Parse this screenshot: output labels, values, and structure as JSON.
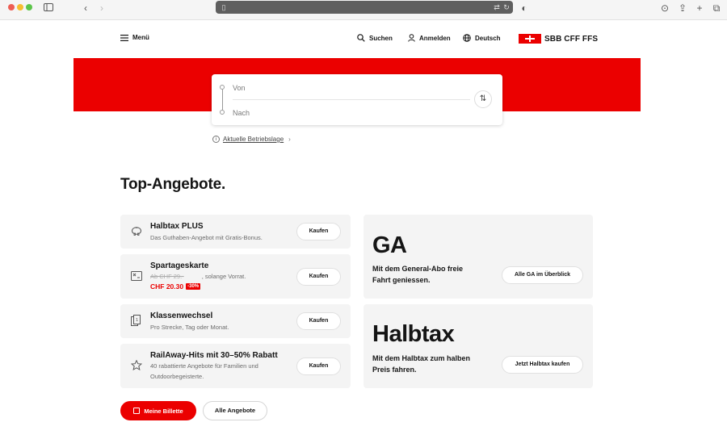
{
  "header": {
    "menu_label": "Menü",
    "search_label": "Suchen",
    "login_label": "Anmelden",
    "language_label": "Deutsch",
    "logo_text": "SBB CFF FFS"
  },
  "search": {
    "from_placeholder": "Von",
    "to_placeholder": "Nach"
  },
  "status_link": "Aktuelle Betriebslage",
  "section_title": "Top-Angebote.",
  "offers": [
    {
      "title": "Halbtax PLUS",
      "subtitle": "Das Guthaben-Angebot mit Gratis-Bonus.",
      "button": "Kaufen",
      "icon": "piggy-bank-icon"
    },
    {
      "title": "Spartageskarte",
      "old_price": "Ab CHF 29.-",
      "subtitle": ", solange Vorrat.",
      "price": "CHF 20.30",
      "discount": "-30%",
      "button": "Kaufen",
      "icon": "ticket-icon"
    },
    {
      "title": "Klassenwechsel",
      "subtitle": "Pro Strecke, Tag oder Monat.",
      "button": "Kaufen",
      "icon": "class-change-icon"
    },
    {
      "title": "RailAway-Hits mit 30–50% Rabatt",
      "subtitle_line1": "40 rabattierte Angebote für Familien und",
      "subtitle_line2": "Outdoorbegeisterte.",
      "button": "Kaufen",
      "icon": "star-icon"
    }
  ],
  "ga": {
    "title": "GA",
    "desc_line1": "Mit dem General-Abo freie",
    "desc_line2": "Fahrt geniessen.",
    "button": "Alle GA im Überblick"
  },
  "halbtax": {
    "title": "Halbtax",
    "desc_line1": "Mit dem Halbtax zum halben",
    "desc_line2": "Preis fahren.",
    "button": "Jetzt Halbtax kaufen"
  },
  "buttons": {
    "my_tickets": "Meine Billette",
    "all_offers": "Alle Angebote"
  },
  "colors": {
    "brand_red": "#eb0000"
  }
}
